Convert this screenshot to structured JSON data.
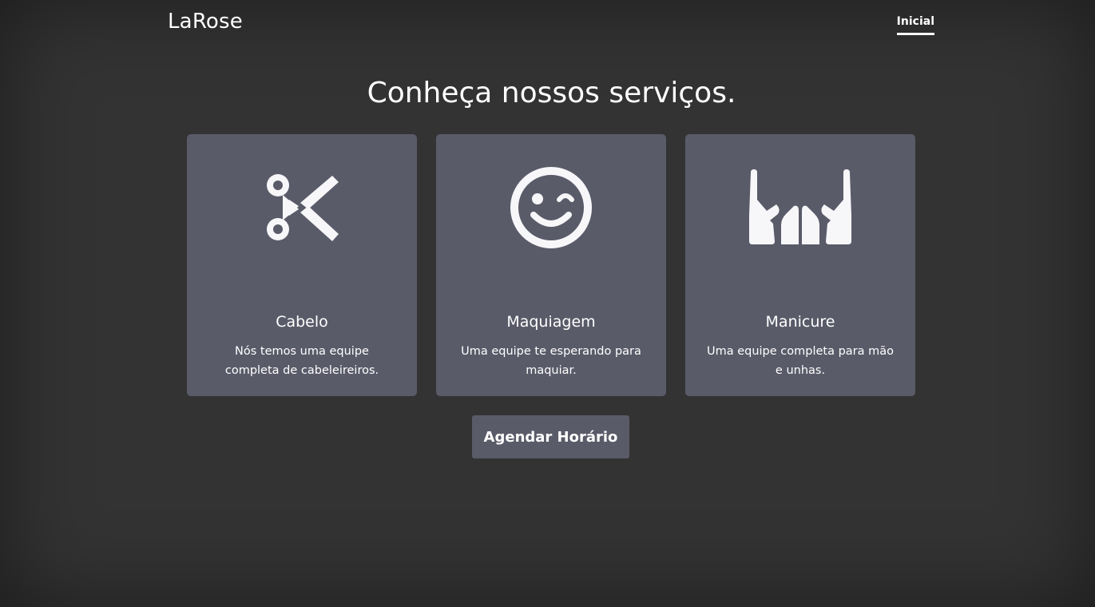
{
  "header": {
    "brand": "LaRose",
    "nav": [
      {
        "label": "Inicial"
      }
    ]
  },
  "main": {
    "headline": "Conheça nossos serviços.",
    "services": [
      {
        "icon": "scissors-icon",
        "title": "Cabelo",
        "description": "Nós temos uma equipe completa de cabeleireiros."
      },
      {
        "icon": "wink-face-icon",
        "title": "Maquiagem",
        "description": "Uma equipe te esperando para maquiar."
      },
      {
        "icon": "hands-icon",
        "title": "Manicure",
        "description": "Uma equipe completa para mão e unhas."
      }
    ],
    "cta_label": "Agendar Horário"
  },
  "colors": {
    "background": "#333333",
    "card": "#5a5b69",
    "text": "#ffffff"
  }
}
